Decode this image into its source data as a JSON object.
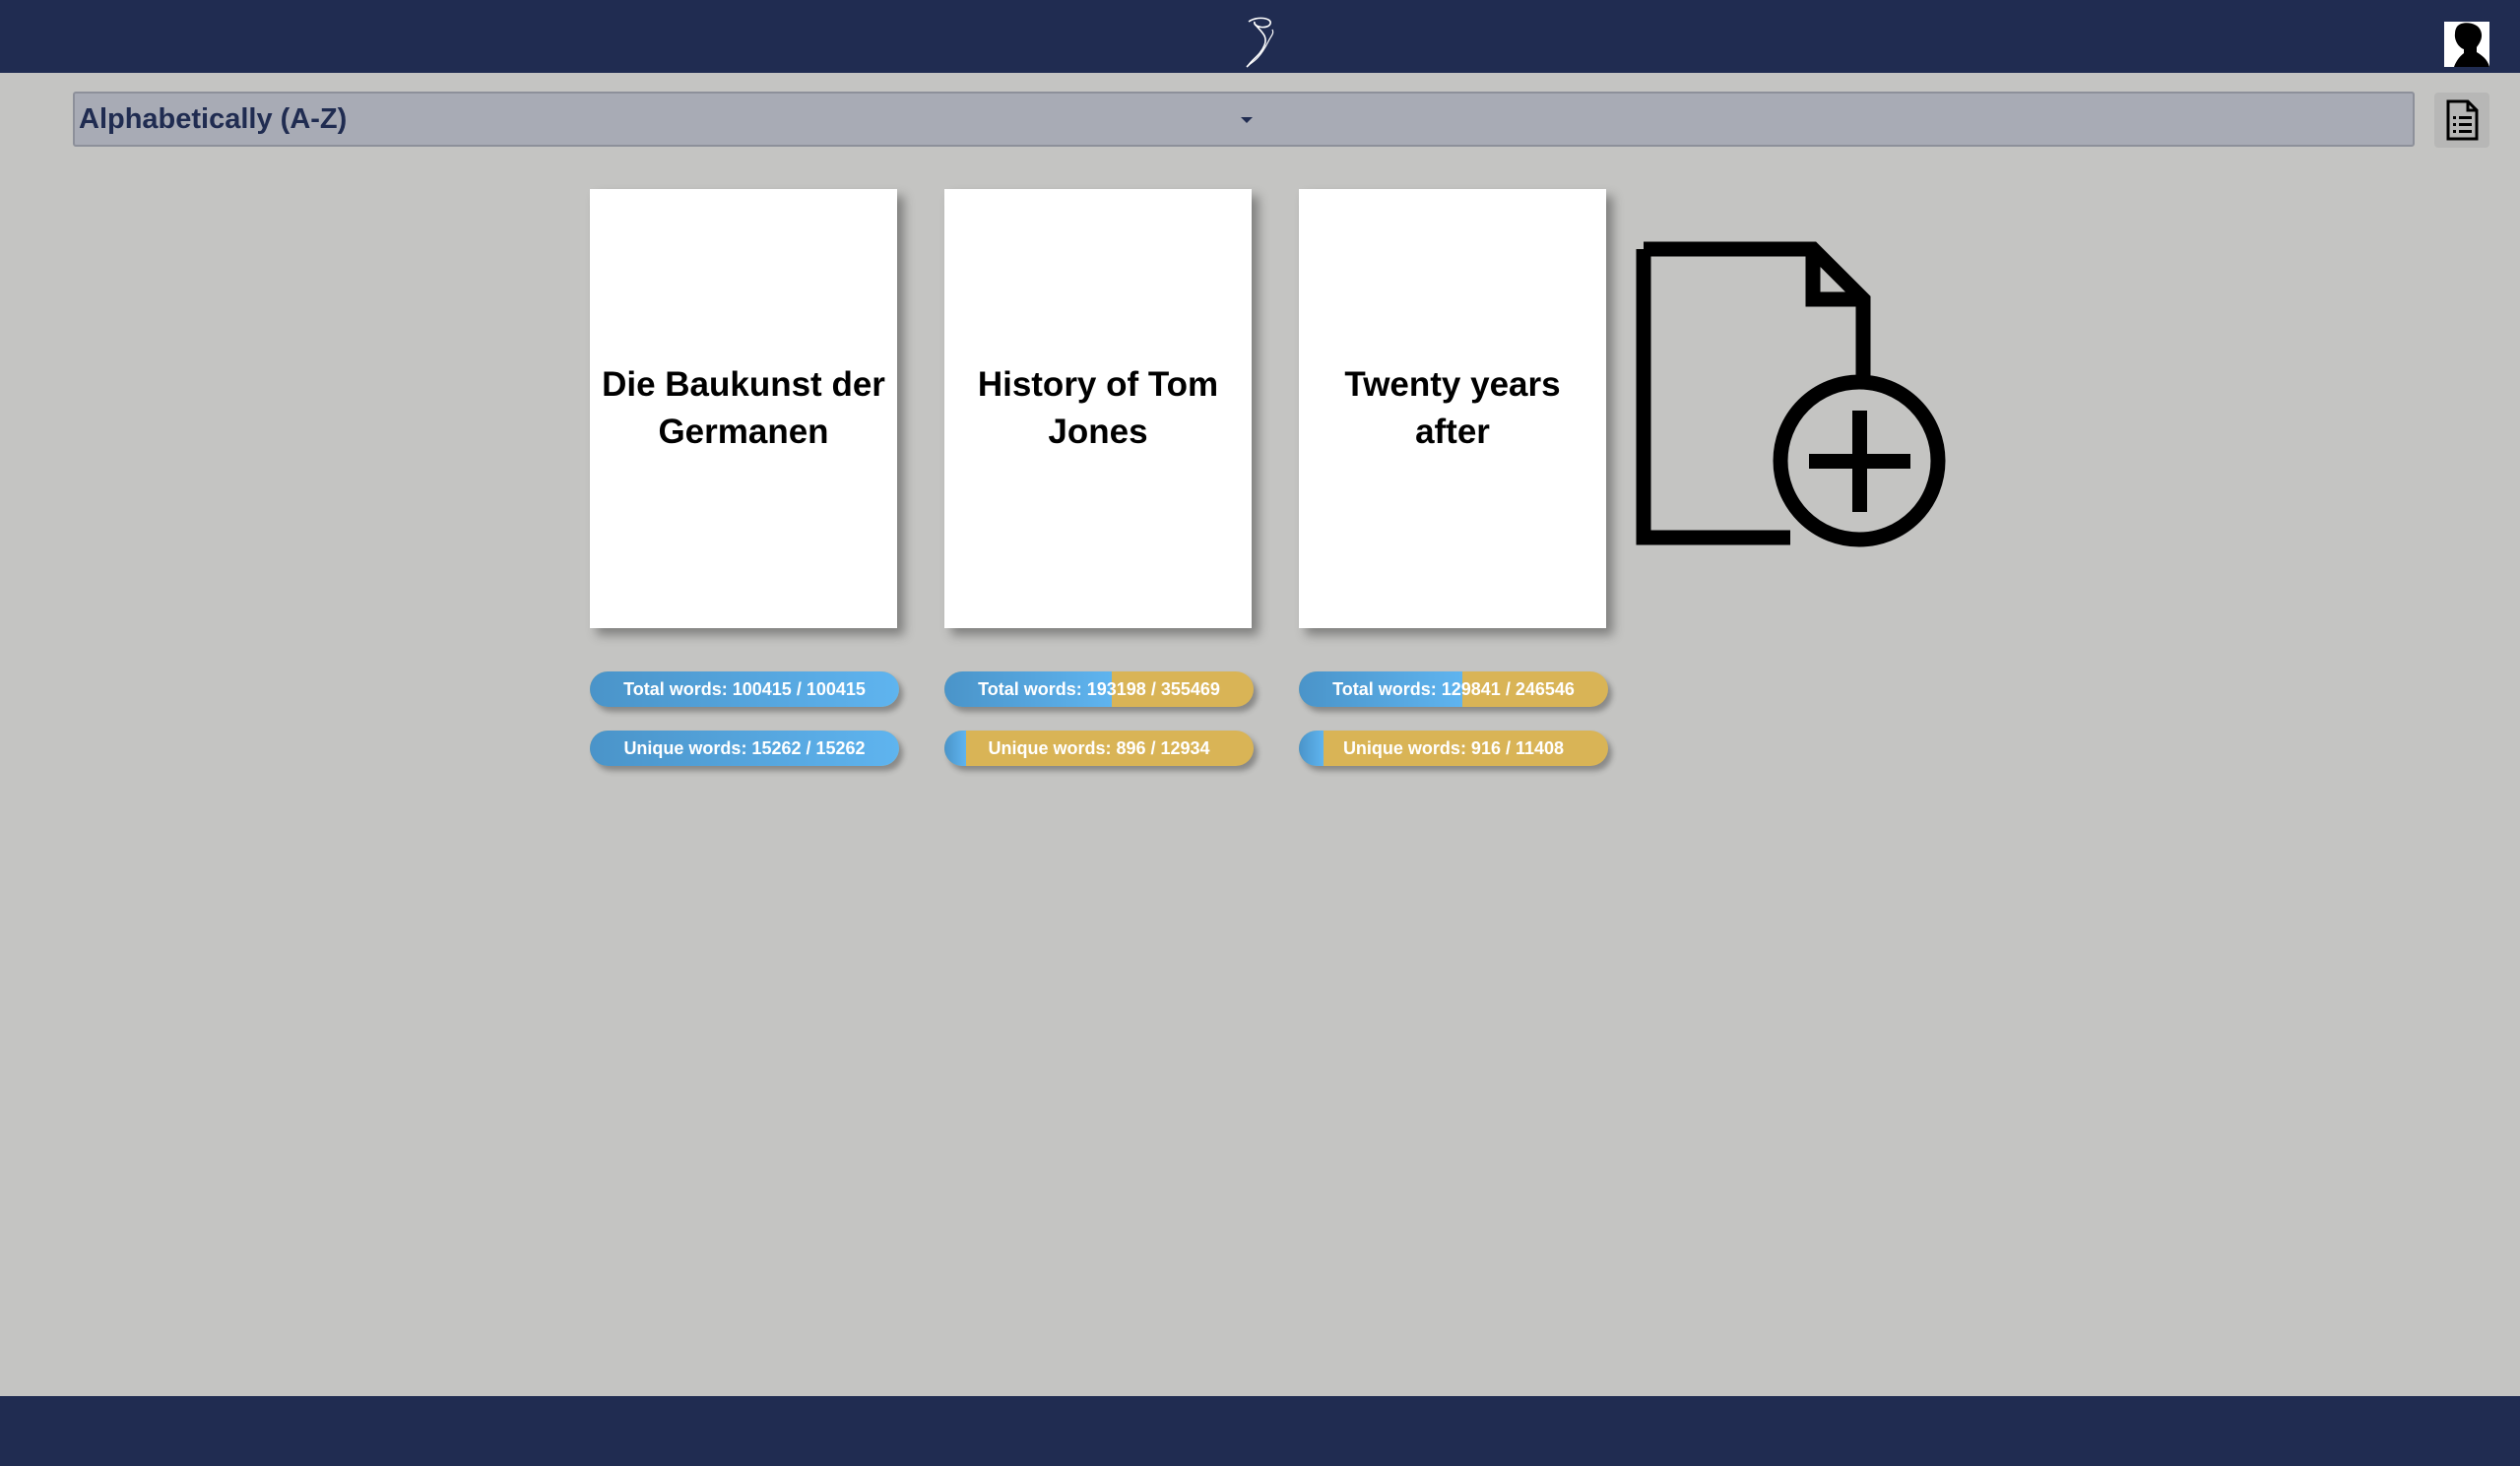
{
  "header": {
    "logo_icon": "quill-logo-icon",
    "avatar_icon": "user-avatar-icon"
  },
  "sort": {
    "selected": "Alphabetically (A-Z)"
  },
  "toolbar": {
    "list_view_icon": "document-list-icon"
  },
  "books": [
    {
      "title": "Die Baukunst der Germanen",
      "total_words_label": "Total words: 100415 / 100415",
      "total_words_progress": 1.0,
      "unique_words_label": "Unique words: 15262 / 15262",
      "unique_words_progress": 1.0
    },
    {
      "title": "History of Tom Jones",
      "total_words_label": "Total words: 193198 / 355469",
      "total_words_progress": 0.54,
      "unique_words_label": "Unique words: 896 / 12934",
      "unique_words_progress": 0.07
    },
    {
      "title": "Twenty years after",
      "total_words_label": "Total words: 129841 / 246546",
      "total_words_progress": 0.53,
      "unique_words_label": "Unique words: 916 / 11408",
      "unique_words_progress": 0.08
    }
  ],
  "add_book": {
    "icon": "add-document-icon"
  },
  "colors": {
    "header_bg": "#202c51",
    "page_bg": "#c4c4c2",
    "progress_known": "#5fb4ef",
    "progress_unknown": "#d9b456"
  }
}
